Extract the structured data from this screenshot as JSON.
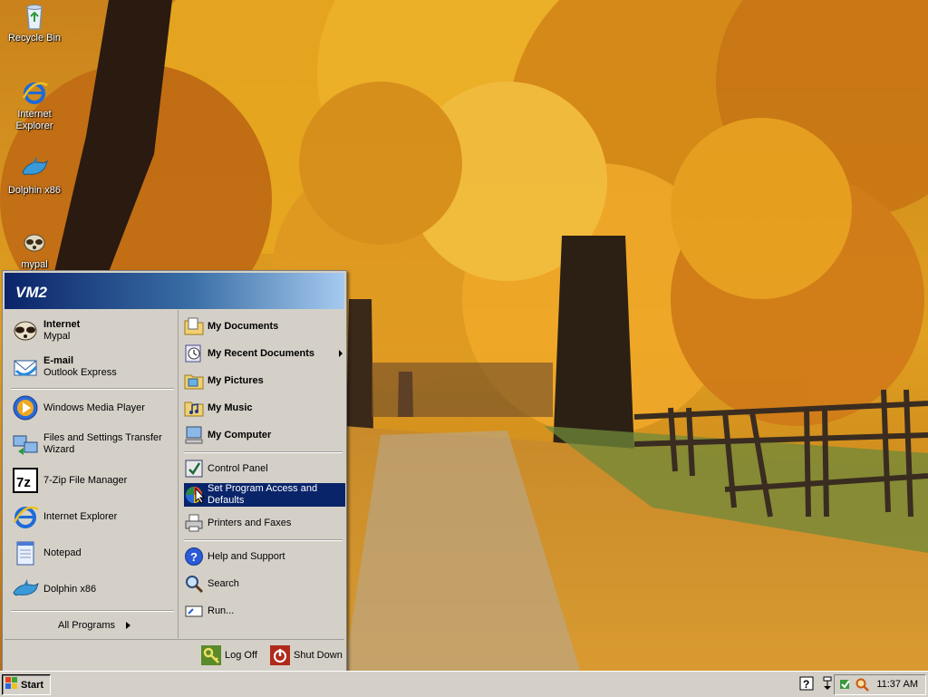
{
  "desktop": {
    "icons": [
      {
        "label": "Recycle Bin",
        "icon": "recycle-bin-icon"
      },
      {
        "label": "Internet\nExplorer",
        "icon": "internet-explorer-icon"
      },
      {
        "label": "Dolphin x86",
        "icon": "dolphin-icon"
      },
      {
        "label": "mypal",
        "icon": "mypal-icon"
      }
    ]
  },
  "start_menu": {
    "user": "VM2",
    "pinned": [
      {
        "title": "Internet",
        "subtitle": "Mypal",
        "icon": "mypal-icon"
      },
      {
        "title": "E-mail",
        "subtitle": "Outlook Express",
        "icon": "outlook-express-icon"
      }
    ],
    "recent": [
      {
        "label": "Windows Media Player",
        "icon": "media-player-icon"
      },
      {
        "label": "Files and Settings Transfer Wizard",
        "icon": "transfer-wizard-icon"
      },
      {
        "label": "7-Zip File Manager",
        "icon": "7zip-icon"
      },
      {
        "label": "Internet Explorer",
        "icon": "internet-explorer-icon"
      },
      {
        "label": "Notepad",
        "icon": "notepad-icon"
      },
      {
        "label": "Dolphin x86",
        "icon": "dolphin-icon"
      }
    ],
    "all_programs": "All Programs",
    "places": [
      {
        "label": "My Documents",
        "icon": "my-documents-icon"
      },
      {
        "label": "My Recent Documents",
        "icon": "recent-documents-icon"
      },
      {
        "label": "My Pictures",
        "icon": "my-pictures-icon"
      },
      {
        "label": "My Music",
        "icon": "my-music-icon"
      },
      {
        "label": "My Computer",
        "icon": "my-computer-icon"
      }
    ],
    "settings": [
      {
        "label": "Control Panel",
        "icon": "control-panel-icon"
      },
      {
        "label": "Set Program Access and Defaults",
        "icon": "program-access-icon"
      },
      {
        "label": "Printers and Faxes",
        "icon": "printer-icon"
      }
    ],
    "help": [
      {
        "label": "Help and Support",
        "icon": "help-icon"
      },
      {
        "label": "Search",
        "icon": "search-icon"
      },
      {
        "label": "Run...",
        "icon": "run-icon"
      }
    ],
    "log_off": "Log Off",
    "shut_down": "Shut Down"
  },
  "taskbar": {
    "start_label": "Start",
    "clock": "11:37 AM"
  },
  "colors": {
    "menu_bg": "#d4d0c8",
    "highlight": "#0a246a",
    "header_gradient_start": "#0a246a",
    "header_gradient_end": "#a6caf0"
  }
}
